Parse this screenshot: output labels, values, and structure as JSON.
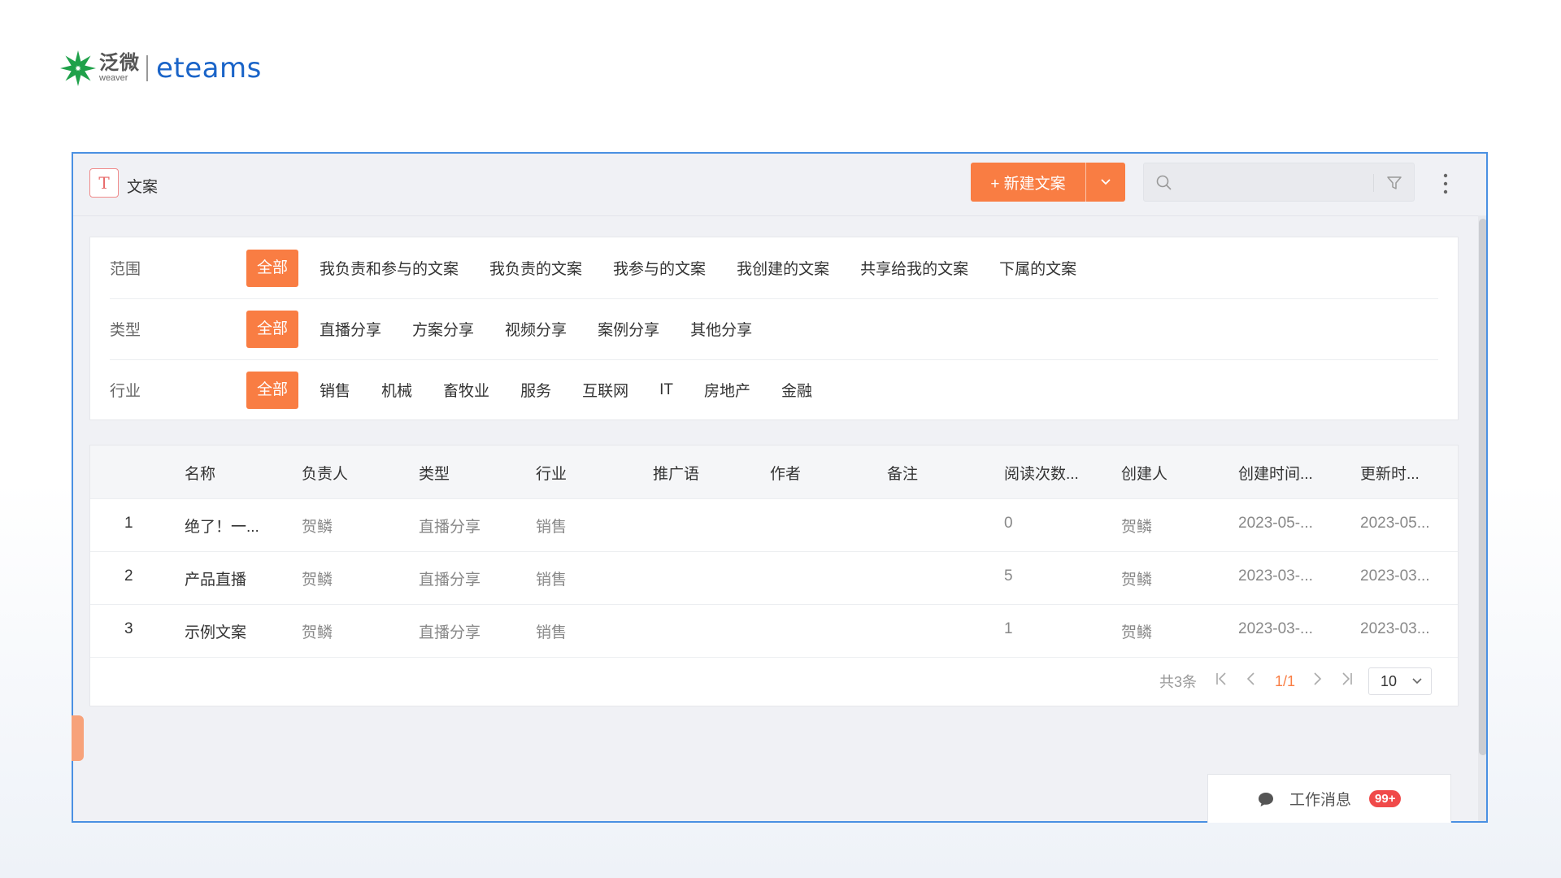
{
  "logo": {
    "cn": "泛微",
    "en_small": "weaver",
    "brand": "eteams",
    "brand_color": "#1a64c8"
  },
  "app": {
    "icon_glyph": "T",
    "title": "文案",
    "new_button_label": "+ 新建文案",
    "search_placeholder": "",
    "accent": "#f97d43"
  },
  "filters": {
    "scope": {
      "label": "范围",
      "options": [
        "全部",
        "我负责和参与的文案",
        "我负责的文案",
        "我参与的文案",
        "我创建的文案",
        "共享给我的文案",
        "下属的文案"
      ]
    },
    "type": {
      "label": "类型",
      "options": [
        "全部",
        "直播分享",
        "方案分享",
        "视频分享",
        "案例分享",
        "其他分享"
      ]
    },
    "industry": {
      "label": "行业",
      "options": [
        "全部",
        "销售",
        "机械",
        "畜牧业",
        "服务",
        "互联网",
        "IT",
        "房地产",
        "金融"
      ]
    }
  },
  "table": {
    "headers": [
      "名称",
      "负责人",
      "类型",
      "行业",
      "推广语",
      "作者",
      "备注",
      "阅读次数...",
      "创建人",
      "创建时间...",
      "更新时..."
    ],
    "rows": [
      {
        "index": "1",
        "name": "绝了！一...",
        "owner": "贺鳞",
        "type": "直播分享",
        "industry": "销售",
        "promo": "",
        "author": "",
        "note": "",
        "reads": "0",
        "creator": "贺鳞",
        "created": "2023-05-...",
        "updated": "2023-05..."
      },
      {
        "index": "2",
        "name": "产品直播",
        "owner": "贺鳞",
        "type": "直播分享",
        "industry": "销售",
        "promo": "",
        "author": "",
        "note": "",
        "reads": "5",
        "creator": "贺鳞",
        "created": "2023-03-...",
        "updated": "2023-03..."
      },
      {
        "index": "3",
        "name": "示例文案",
        "owner": "贺鳞",
        "type": "直播分享",
        "industry": "销售",
        "promo": "",
        "author": "",
        "note": "",
        "reads": "1",
        "creator": "贺鳞",
        "created": "2023-03-...",
        "updated": "2023-03..."
      }
    ]
  },
  "pager": {
    "total": "共3条",
    "current": "1/1",
    "page_size": "10"
  },
  "message": {
    "label": "工作消息",
    "badge": "99+"
  }
}
